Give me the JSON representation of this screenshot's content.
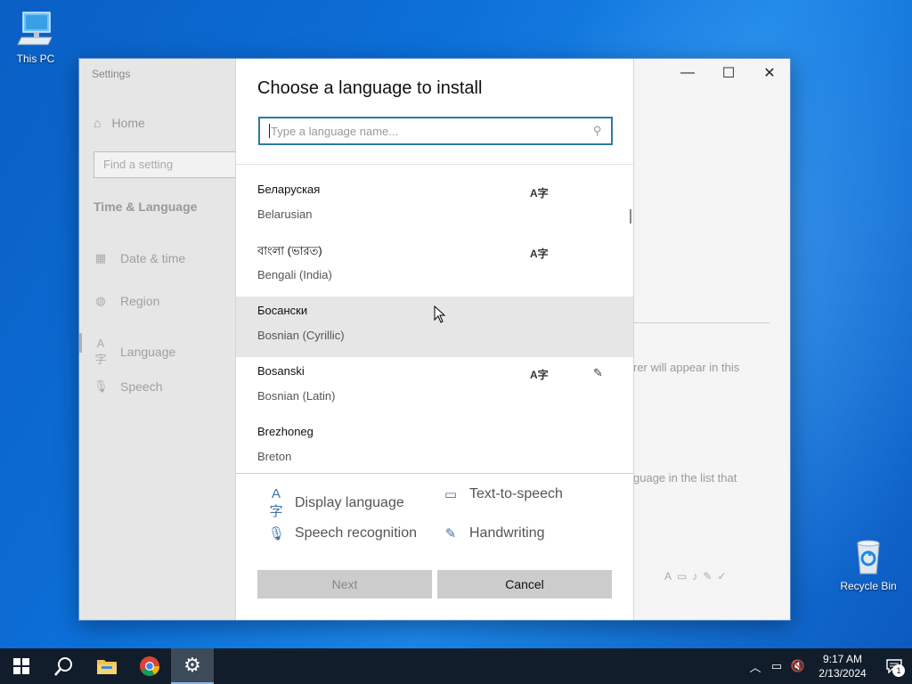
{
  "desktop": {
    "icons": [
      {
        "label": "This PC"
      },
      {
        "label": "Recycle Bin"
      }
    ]
  },
  "settings": {
    "title": "Settings",
    "home_label": "Home",
    "find_placeholder": "Find a setting",
    "section_title": "Time & Language",
    "nav": [
      {
        "label": "Date & time",
        "icon": "calendar-clock-icon"
      },
      {
        "label": "Region",
        "icon": "globe-icon"
      },
      {
        "label": "Language",
        "icon": "language-icon"
      },
      {
        "label": "Speech",
        "icon": "microphone-icon"
      }
    ],
    "background_text": {
      "line1": "rer will appear in this",
      "line2": "guage in the list that"
    }
  },
  "dialog": {
    "title": "Choose a language to install",
    "search_placeholder": "Type a language name...",
    "languages": [
      {
        "native": "Беларуская",
        "english": "Belarusian",
        "display": true,
        "handwriting": false
      },
      {
        "native": "বাংলা (ভারত)",
        "english": "Bengali (India)",
        "display": true,
        "handwriting": false
      },
      {
        "native": "Босански",
        "english": "Bosnian (Cyrillic)",
        "display": false,
        "handwriting": false
      },
      {
        "native": "Bosanski",
        "english": "Bosnian (Latin)",
        "display": true,
        "handwriting": true
      },
      {
        "native": "Brezhoneg",
        "english": "Breton",
        "display": false,
        "handwriting": false
      }
    ],
    "features": {
      "display_language": "Display language",
      "text_to_speech": "Text-to-speech",
      "speech_recognition": "Speech recognition",
      "handwriting": "Handwriting"
    },
    "buttons": {
      "next": "Next",
      "cancel": "Cancel"
    }
  },
  "taskbar": {
    "time": "9:17 AM",
    "date": "2/13/2024",
    "notification_count": "1"
  },
  "colors": {
    "accent": "#2f7aa3",
    "desktop": "#0c6fd8",
    "taskbar": "#111d2b"
  }
}
